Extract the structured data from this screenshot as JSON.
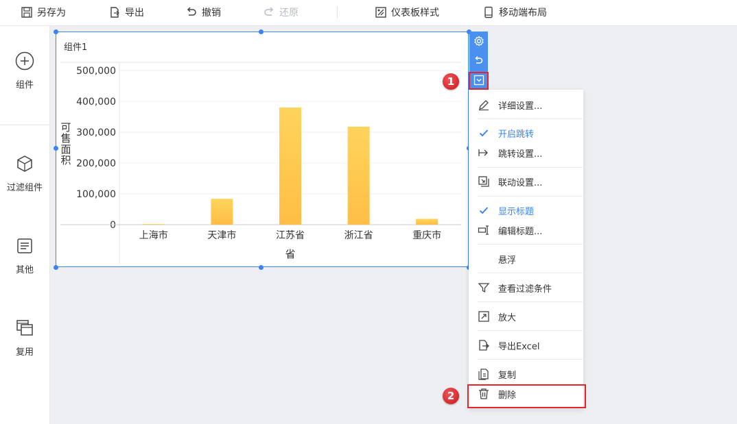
{
  "toolbar": {
    "save_as": "另存为",
    "export": "导出",
    "undo": "撤销",
    "redo": "还原",
    "dashboard_style": "仪表板样式",
    "mobile_layout": "移动端布局"
  },
  "sidebar": {
    "items": [
      {
        "label": "组件",
        "icon": "plus-circle-icon"
      },
      {
        "label": "过滤组件",
        "icon": "cube-icon"
      },
      {
        "label": "其他",
        "icon": "text-doc-icon"
      },
      {
        "label": "复用",
        "icon": "copy-windows-icon"
      }
    ]
  },
  "widget": {
    "title": "组件1"
  },
  "chart_data": {
    "type": "bar",
    "title": "",
    "xlabel": "省",
    "ylabel": "可售面积",
    "categories": [
      "上海市",
      "天津市",
      "江苏省",
      "浙江省",
      "重庆市"
    ],
    "series": [
      {
        "values": [
          2000,
          84000,
          380000,
          318000,
          19000
        ]
      }
    ],
    "yticks": [
      "500,000",
      "400,000",
      "300,000",
      "200,000",
      "100,000",
      "0"
    ],
    "ylim": [
      0,
      500000
    ],
    "bar_color": "#ffc94f",
    "grid": true
  },
  "menu": {
    "items": [
      {
        "label": "详细设置...",
        "icon": "pencil-icon",
        "checked": false
      },
      {
        "label": "开启跳转",
        "icon": "check-icon",
        "checked": true
      },
      {
        "label": "跳转设置...",
        "icon": "jump-arrow-icon",
        "checked": false
      },
      {
        "label": "联动设置...",
        "icon": "link-window-icon",
        "checked": false
      },
      {
        "label": "显示标题",
        "icon": "check-icon",
        "checked": true
      },
      {
        "label": "编辑标题...",
        "icon": "text-cursor-icon",
        "checked": false
      },
      {
        "label": "悬浮",
        "icon": "",
        "checked": false
      },
      {
        "label": "查看过滤条件",
        "icon": "filter-icon",
        "checked": false
      },
      {
        "label": "放大",
        "icon": "expand-icon",
        "checked": false
      },
      {
        "label": "导出Excel",
        "icon": "export-file-icon",
        "checked": false
      },
      {
        "label": "复制",
        "icon": "copy-doc-icon",
        "checked": false
      },
      {
        "label": "删除",
        "icon": "trash-icon",
        "checked": false
      }
    ]
  },
  "annotations": {
    "badge1": "1",
    "badge2": "2"
  },
  "colors": {
    "accent": "#3b83f6",
    "highlight": "#e2262c",
    "bar": "#ffc94f"
  }
}
